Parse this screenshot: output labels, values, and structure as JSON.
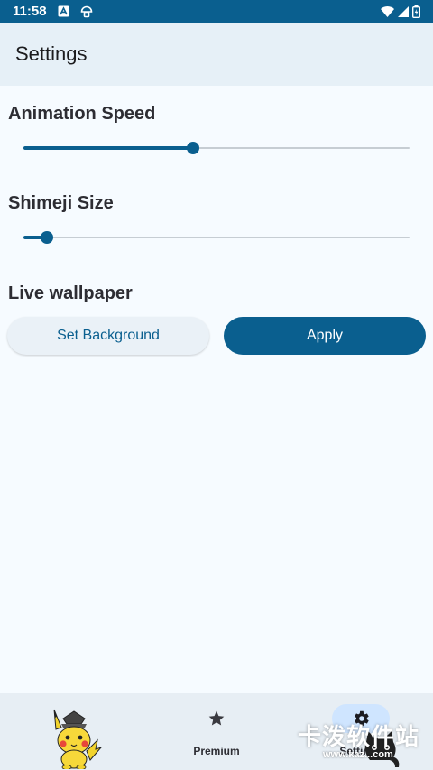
{
  "status_bar": {
    "time": "11:58",
    "icons": [
      "text-a-icon",
      "mushroom-icon",
      "wifi-icon",
      "signal-icon",
      "battery-icon"
    ]
  },
  "app_bar": {
    "title": "Settings"
  },
  "animation_speed": {
    "label": "Animation Speed",
    "value_fraction": 0.44
  },
  "shimeji_size": {
    "label": "Shimeji Size",
    "value_fraction": 0.06
  },
  "live_wallpaper": {
    "label": "Live wallpaper",
    "set_background_label": "Set Background",
    "apply_label": "Apply"
  },
  "bottom_nav": {
    "items": [
      {
        "label": "",
        "icon": "pikachu-mascot-icon"
      },
      {
        "label": "Premium",
        "icon": "star-icon"
      },
      {
        "label": "Settings",
        "icon": "gear-icon",
        "active": true
      }
    ]
  },
  "watermark": {
    "text": "卡泼软件站",
    "url": "www.kaz...com"
  },
  "colors": {
    "primary": "#0a5f8f",
    "background": "#f6fbff",
    "app_bar": "#e6f0f7",
    "nav_bar": "#e7eef4",
    "active_indicator": "#cfe5ff"
  }
}
